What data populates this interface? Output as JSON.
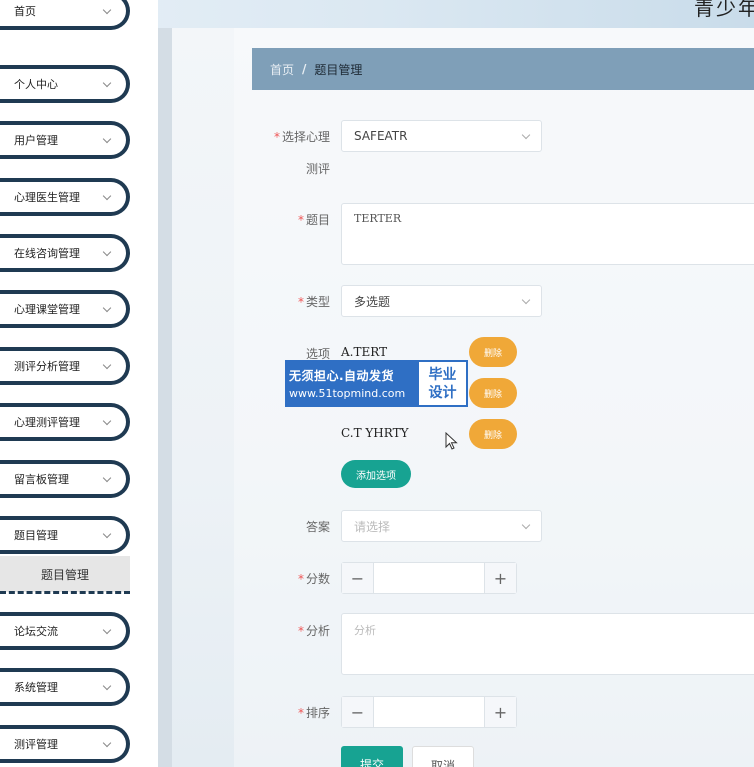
{
  "header": {
    "app_title": "青少年"
  },
  "sidebar": {
    "items": [
      {
        "label": "首页"
      },
      {
        "label": "个人中心"
      },
      {
        "label": "用户管理"
      },
      {
        "label": "心理医生管理"
      },
      {
        "label": "在线咨询管理"
      },
      {
        "label": "心理课堂管理"
      },
      {
        "label": "测评分析管理"
      },
      {
        "label": "心理测评管理"
      },
      {
        "label": "留言板管理"
      },
      {
        "label": "题目管理"
      },
      {
        "label": "论坛交流"
      },
      {
        "label": "系统管理"
      },
      {
        "label": "测评管理"
      }
    ],
    "sub_item": "题目管理"
  },
  "breadcrumb": {
    "home": "首页",
    "separator": "/",
    "current": "题目管理"
  },
  "form": {
    "survey_label": "选择心理",
    "survey_label_2": "测评",
    "survey_value": "SAFEATR",
    "question_label": "题目",
    "question_value": "TERTER",
    "type_label": "类型",
    "type_value": "多选题",
    "options_label": "选项",
    "options": [
      {
        "text": "A.TERT",
        "delete": "删除"
      },
      {
        "text": "",
        "delete": "删除"
      },
      {
        "text": "C.T YHRTY",
        "delete": "删除"
      }
    ],
    "add_option": "添加选项",
    "answer_label": "答案",
    "answer_placeholder": "请选择",
    "score_label": "分数",
    "analysis_label": "分析",
    "analysis_placeholder": "分析",
    "order_label": "排序",
    "stepper_minus": "−",
    "stepper_plus": "+",
    "submit": "提交",
    "cancel": "取消"
  },
  "watermark": {
    "line1": "无须担心.自动发货",
    "line2": "www.51topmind.com",
    "badge_line1": "毕业",
    "badge_line2": "设计"
  }
}
